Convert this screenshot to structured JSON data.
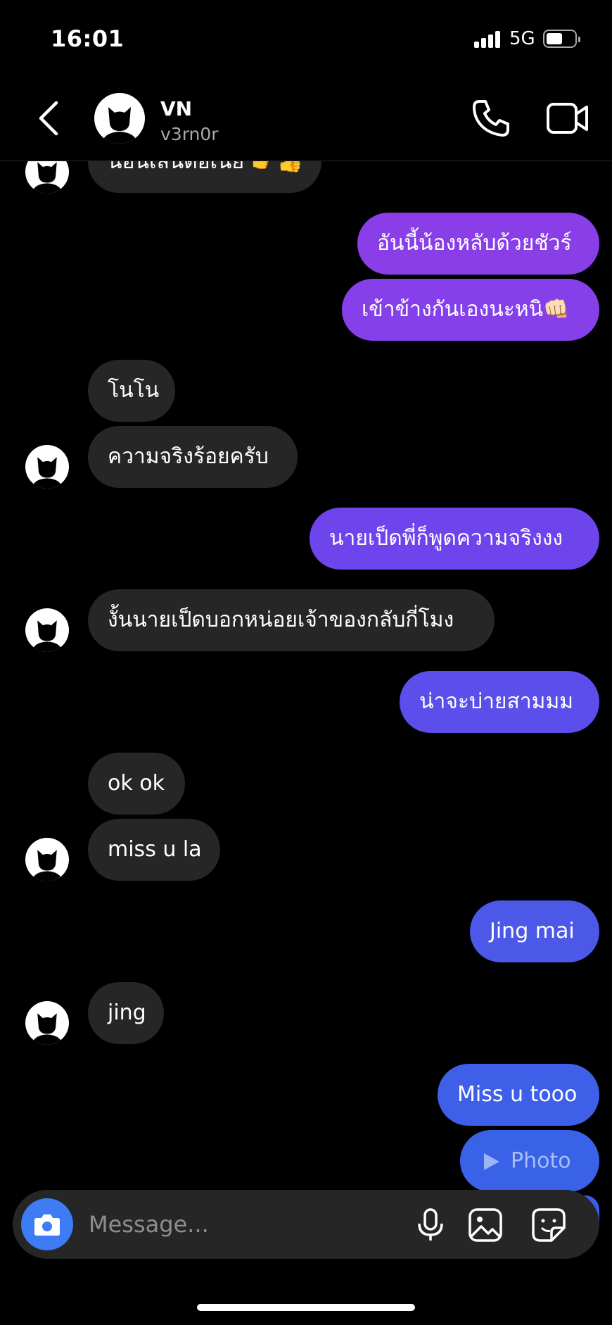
{
  "status": {
    "time": "16:01",
    "network": "5G",
    "battery_level": 0.55
  },
  "header": {
    "name": "VN",
    "username": "v3rn0r"
  },
  "messages": [
    {
      "dir": "in",
      "text": "น้อนเล่นต่อเนี่ย 👉👍"
    },
    {
      "dir": "out",
      "text": "อันนี้น้องหลับด้วยชัวร์"
    },
    {
      "dir": "out",
      "text": "เข้าข้างกันเองนะหนิ👊🏻"
    },
    {
      "dir": "in",
      "text": "โนโน"
    },
    {
      "dir": "in",
      "text": "ความจริงร้อยครับ"
    },
    {
      "dir": "out",
      "text": "นายเป็ดพี่ก็พูดความจริงงง"
    },
    {
      "dir": "in",
      "text": "งั้นนายเป็ดบอกหน่อยเจ้าของกลับกี่โมง"
    },
    {
      "dir": "out",
      "text": "น่าจะบ่ายสามมม"
    },
    {
      "dir": "in",
      "text": "ok ok"
    },
    {
      "dir": "in",
      "text": "miss u la"
    },
    {
      "dir": "out",
      "text": "Jing mai"
    },
    {
      "dir": "in",
      "text": "jing"
    },
    {
      "dir": "out",
      "text": "Miss u tooo"
    },
    {
      "dir": "out",
      "text": "Photo"
    }
  ],
  "composer": {
    "placeholder": "Message..."
  },
  "icons": [
    "back-arrow-icon",
    "phone-icon",
    "video-camera-icon",
    "camera-icon",
    "microphone-icon",
    "gallery-icon",
    "sticker-icon",
    "play-icon"
  ],
  "colors": {
    "incoming": "#262626",
    "outgoing_top": "#8a3ee8",
    "outgoing_bottom": "#3a5ee6",
    "camera_button": "#3d7cf4"
  }
}
